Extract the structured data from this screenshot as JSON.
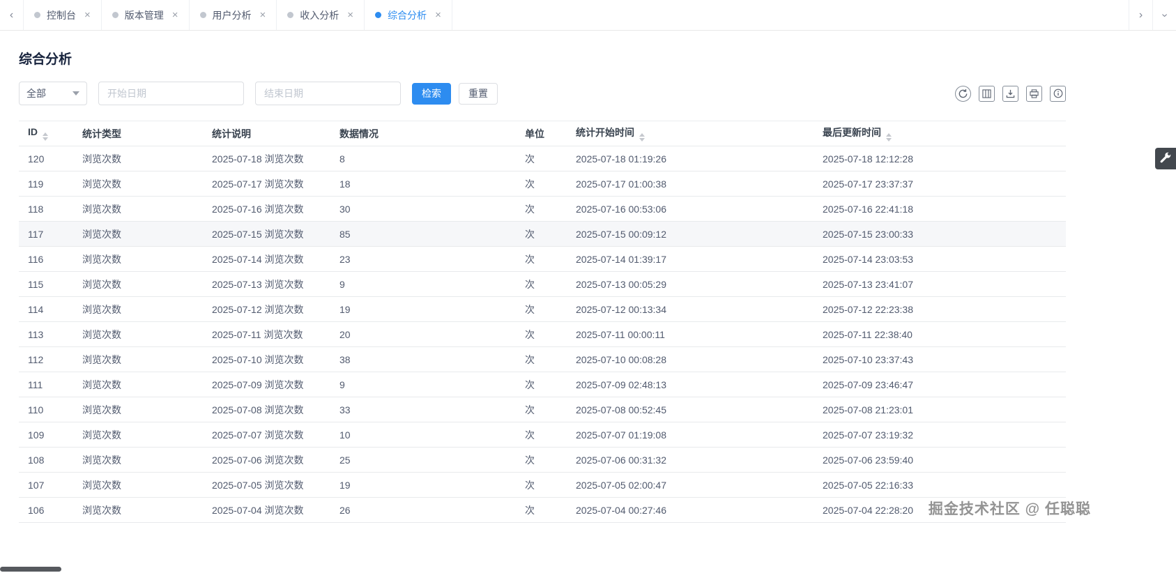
{
  "colors": {
    "accent": "#2d8cf0",
    "tab_inactive_dot": "#c2c7cf",
    "border": "#e8eaec",
    "fab_bg": "#43484e"
  },
  "tabbar": {
    "tabs": [
      {
        "label": "控制台",
        "active": false
      },
      {
        "label": "版本管理",
        "active": false
      },
      {
        "label": "用户分析",
        "active": false
      },
      {
        "label": "收入分析",
        "active": false
      },
      {
        "label": "综合分析",
        "active": true
      }
    ],
    "close_glyph": "×",
    "scroll_left_glyph": "‹",
    "scroll_right_glyph": "›"
  },
  "page": {
    "title": "综合分析"
  },
  "filters": {
    "type_select_value": "全部",
    "start_date_placeholder": "开始日期",
    "end_date_placeholder": "结束日期",
    "search_label": "检索",
    "reset_label": "重置"
  },
  "toolbar": {
    "icons": [
      {
        "name": "refresh-icon"
      },
      {
        "name": "column-settings-icon"
      },
      {
        "name": "export-icon"
      },
      {
        "name": "print-icon"
      },
      {
        "name": "info-icon"
      }
    ]
  },
  "table": {
    "columns": [
      {
        "label": "ID",
        "sortable": true
      },
      {
        "label": "统计类型",
        "sortable": false
      },
      {
        "label": "统计说明",
        "sortable": false
      },
      {
        "label": "数据情况",
        "sortable": false
      },
      {
        "label": "单位",
        "sortable": false
      },
      {
        "label": "统计开始时间",
        "sortable": true
      },
      {
        "label": "最后更新时间",
        "sortable": true
      }
    ],
    "highlighted_row_index": 3,
    "rows": [
      [
        "120",
        "浏览次数",
        "2025-07-18 浏览次数",
        "8",
        "次",
        "2025-07-18 01:19:26",
        "2025-07-18 12:12:28"
      ],
      [
        "119",
        "浏览次数",
        "2025-07-17 浏览次数",
        "18",
        "次",
        "2025-07-17 01:00:38",
        "2025-07-17 23:37:37"
      ],
      [
        "118",
        "浏览次数",
        "2025-07-16 浏览次数",
        "30",
        "次",
        "2025-07-16 00:53:06",
        "2025-07-16 22:41:18"
      ],
      [
        "117",
        "浏览次数",
        "2025-07-15 浏览次数",
        "85",
        "次",
        "2025-07-15 00:09:12",
        "2025-07-15 23:00:33"
      ],
      [
        "116",
        "浏览次数",
        "2025-07-14 浏览次数",
        "23",
        "次",
        "2025-07-14 01:39:17",
        "2025-07-14 23:03:53"
      ],
      [
        "115",
        "浏览次数",
        "2025-07-13 浏览次数",
        "9",
        "次",
        "2025-07-13 00:05:29",
        "2025-07-13 23:41:07"
      ],
      [
        "114",
        "浏览次数",
        "2025-07-12 浏览次数",
        "19",
        "次",
        "2025-07-12 00:13:34",
        "2025-07-12 22:23:38"
      ],
      [
        "113",
        "浏览次数",
        "2025-07-11 浏览次数",
        "20",
        "次",
        "2025-07-11 00:00:11",
        "2025-07-11 22:38:40"
      ],
      [
        "112",
        "浏览次数",
        "2025-07-10 浏览次数",
        "38",
        "次",
        "2025-07-10 00:08:28",
        "2025-07-10 23:37:43"
      ],
      [
        "111",
        "浏览次数",
        "2025-07-09 浏览次数",
        "9",
        "次",
        "2025-07-09 02:48:13",
        "2025-07-09 23:46:47"
      ],
      [
        "110",
        "浏览次数",
        "2025-07-08 浏览次数",
        "33",
        "次",
        "2025-07-08 00:52:45",
        "2025-07-08 21:23:01"
      ],
      [
        "109",
        "浏览次数",
        "2025-07-07 浏览次数",
        "10",
        "次",
        "2025-07-07 01:19:08",
        "2025-07-07 23:19:32"
      ],
      [
        "108",
        "浏览次数",
        "2025-07-06 浏览次数",
        "25",
        "次",
        "2025-07-06 00:31:32",
        "2025-07-06 23:59:40"
      ],
      [
        "107",
        "浏览次数",
        "2025-07-05 浏览次数",
        "19",
        "次",
        "2025-07-05 02:00:47",
        "2025-07-05 22:16:33"
      ],
      [
        "106",
        "浏览次数",
        "2025-07-04 浏览次数",
        "26",
        "次",
        "2025-07-04 00:27:46",
        "2025-07-04 22:28:20"
      ]
    ]
  },
  "watermark": {
    "text": "掘金技术社区 @ 任聪聪"
  }
}
